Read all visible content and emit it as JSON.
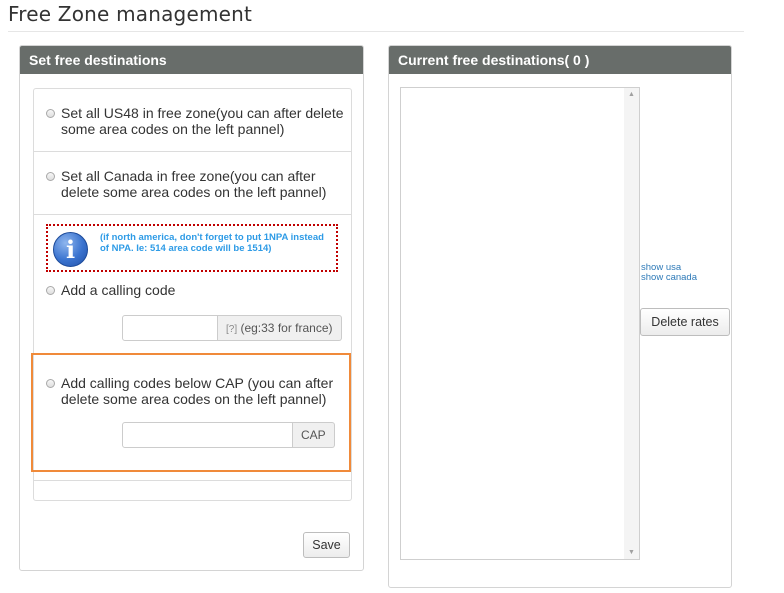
{
  "page": {
    "title": "Free Zone management"
  },
  "left_panel": {
    "title": "Set free destinations",
    "options": {
      "us48": "Set all US48 in free zone(you can after delete some area codes on the left pannel)",
      "canada": "Set all Canada in free zone(you can after delete some area codes on the left pannel)",
      "calling_code": "Add a calling code",
      "cap": "Add calling codes below CAP (you can after delete some area codes on the left pannel)"
    },
    "info": {
      "icon": "info-icon",
      "glyph": "i",
      "text": "(if north america, don't forget to put 1NPA instead of NPA. Ie: 514 area code will be 1514)"
    },
    "calling_code_input": {
      "value": "",
      "hint_link": "[?]",
      "hint_text": " (eg:33 for france)"
    },
    "cap_input": {
      "value": "",
      "addon": "CAP"
    },
    "save_label": "Save",
    "colors": {
      "header_bg": "#686d6a",
      "highlight": "#f08a3a",
      "info_border": "#c00000",
      "info_text": "#2e9be6"
    }
  },
  "right_panel": {
    "title": "Current free destinations( 0 )",
    "links": {
      "show_usa": "show usa",
      "show_canada": "show canada"
    },
    "delete_label": "Delete rates",
    "scroll_up": "▲",
    "scroll_down": "▼"
  }
}
